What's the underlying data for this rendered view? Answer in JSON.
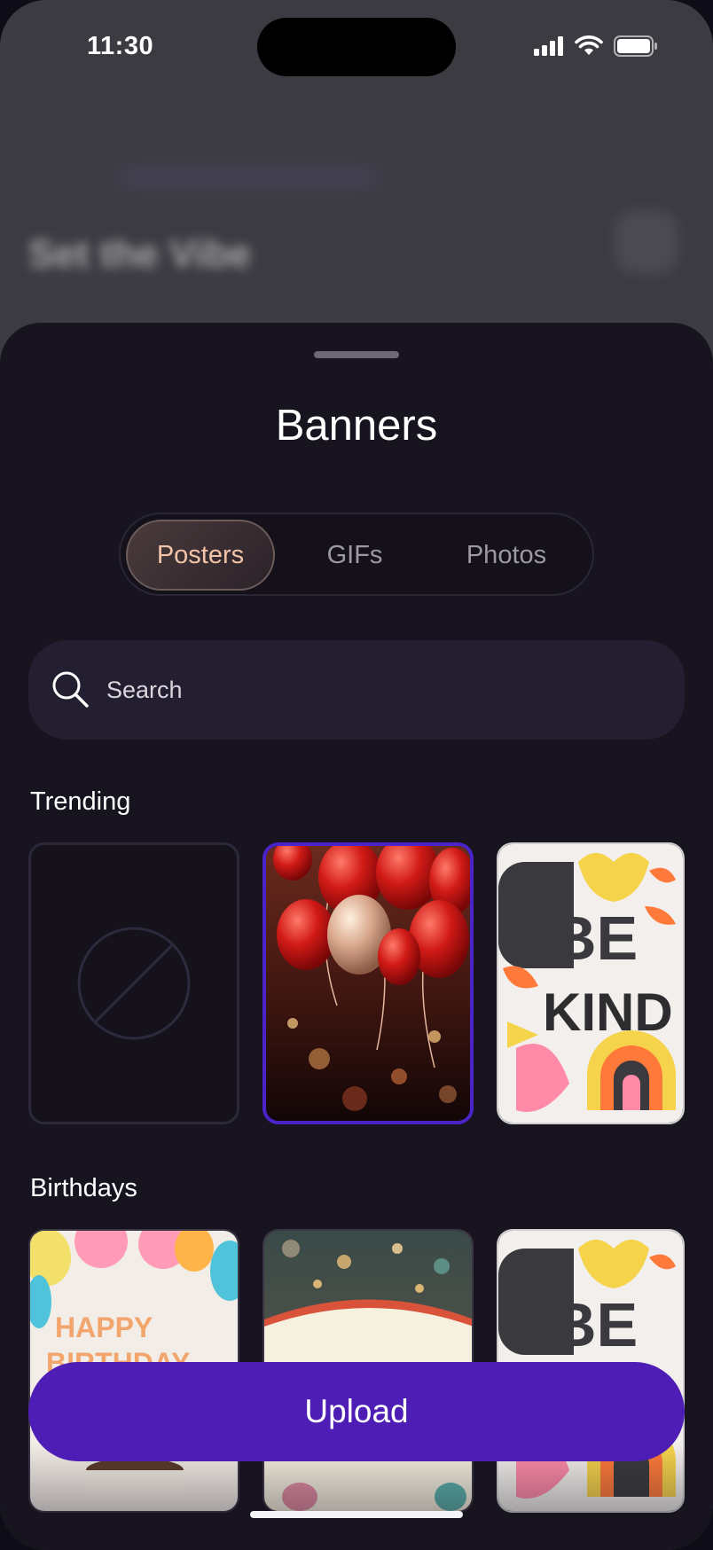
{
  "status_bar": {
    "time": "11:30",
    "icons": [
      "cellular-signal-icon",
      "wifi-icon",
      "battery-icon"
    ]
  },
  "background": {
    "title": "Set the Vibe"
  },
  "sheet": {
    "title": "Banners",
    "tabs": [
      {
        "label": "Posters",
        "selected": true
      },
      {
        "label": "GIFs",
        "selected": false
      },
      {
        "label": "Photos",
        "selected": false
      }
    ],
    "search": {
      "placeholder": "Search",
      "value": ""
    },
    "sections": [
      {
        "label": "Trending",
        "items": [
          "none",
          "red-balloons",
          "be-kind"
        ]
      },
      {
        "label": "Birthdays",
        "items": [
          "happy-birthday",
          "bokeh-banner",
          "be-kind"
        ]
      }
    ],
    "upload_label": "Upload"
  },
  "colors": {
    "accent": "#4d1db5",
    "sheet_bg": "#17131f",
    "active_tab_text": "#f1c4a8"
  }
}
